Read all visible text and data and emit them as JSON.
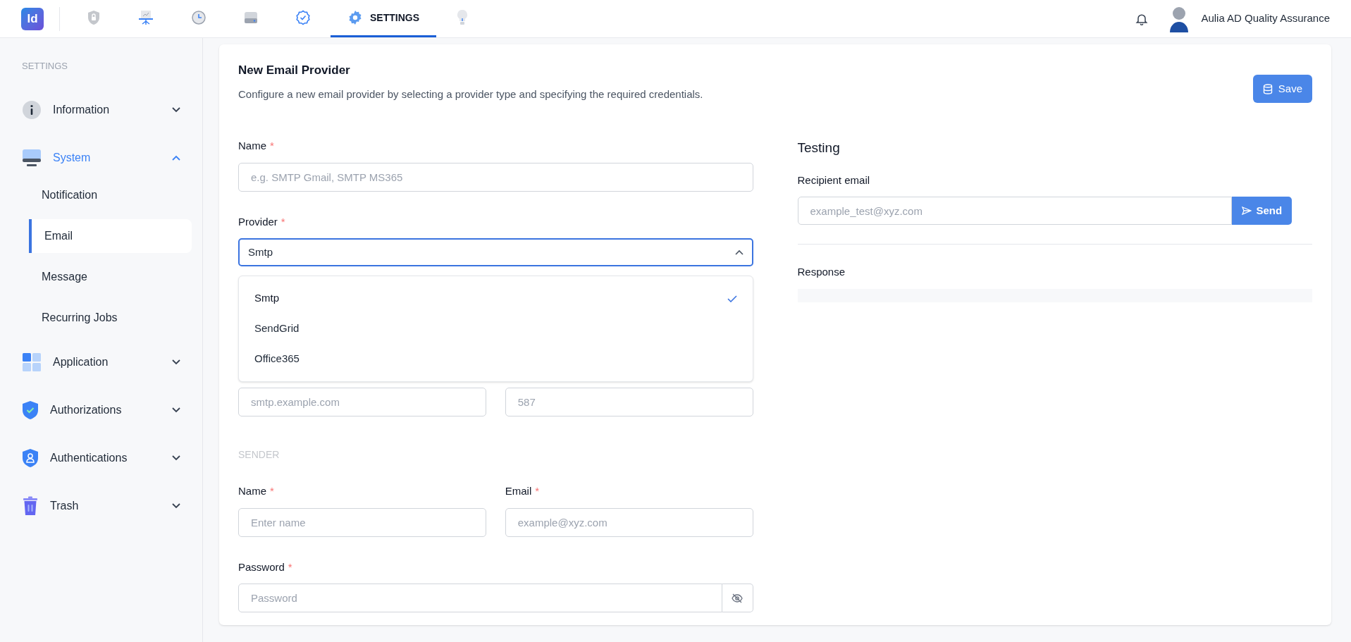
{
  "nav": {
    "logo": "Id",
    "items": [
      {
        "selected": false
      },
      {
        "selected": false
      },
      {
        "selected": false
      },
      {
        "selected": false
      },
      {
        "selected": false
      },
      {
        "label": "SETTINGS",
        "selected": true
      },
      {
        "selected": false
      }
    ],
    "user": "Aulia AD Quality Assurance"
  },
  "sidebar": {
    "heading": "SETTINGS",
    "groups": [
      {
        "label": "Information",
        "expanded": false
      },
      {
        "label": "System",
        "expanded": true,
        "children": [
          {
            "label": "Notification",
            "selected": false
          },
          {
            "label": "Email",
            "selected": true
          },
          {
            "label": "Message",
            "selected": false
          },
          {
            "label": "Recurring Jobs",
            "selected": false
          }
        ]
      },
      {
        "label": "Application",
        "expanded": false
      },
      {
        "label": "Authorizations",
        "expanded": false
      },
      {
        "label": "Authentications",
        "expanded": false
      },
      {
        "label": "Trash",
        "expanded": false
      }
    ]
  },
  "form": {
    "title": "New Email Provider",
    "description": "Configure a new email provider by selecting a provider type and specifying the required credentials.",
    "save_label": "Save",
    "name": {
      "label": "Name",
      "required_mark": "*",
      "placeholder": "e.g. SMTP Gmail, SMTP MS365"
    },
    "provider": {
      "label": "Provider",
      "required_mark": "*",
      "value": "Smtp",
      "expanded": true,
      "options": [
        {
          "label": "Smtp",
          "selected": true
        },
        {
          "label": "SendGrid",
          "selected": false
        },
        {
          "label": "Office365",
          "selected": false
        }
      ]
    },
    "host": {
      "placeholder": "smtp.example.com"
    },
    "port": {
      "placeholder": "587"
    },
    "sender": {
      "heading": "SENDER",
      "name": {
        "label": "Name",
        "required_mark": "*",
        "placeholder": "Enter name"
      },
      "email": {
        "label": "Email",
        "required_mark": "*",
        "placeholder": "example@xyz.com"
      }
    },
    "password": {
      "label": "Password",
      "required_mark": "*",
      "placeholder": "Password"
    }
  },
  "testing": {
    "title": "Testing",
    "recipient": {
      "label": "Recipient email",
      "placeholder": "example_test@xyz.com"
    },
    "send_label": "Send",
    "response_label": "Response"
  }
}
